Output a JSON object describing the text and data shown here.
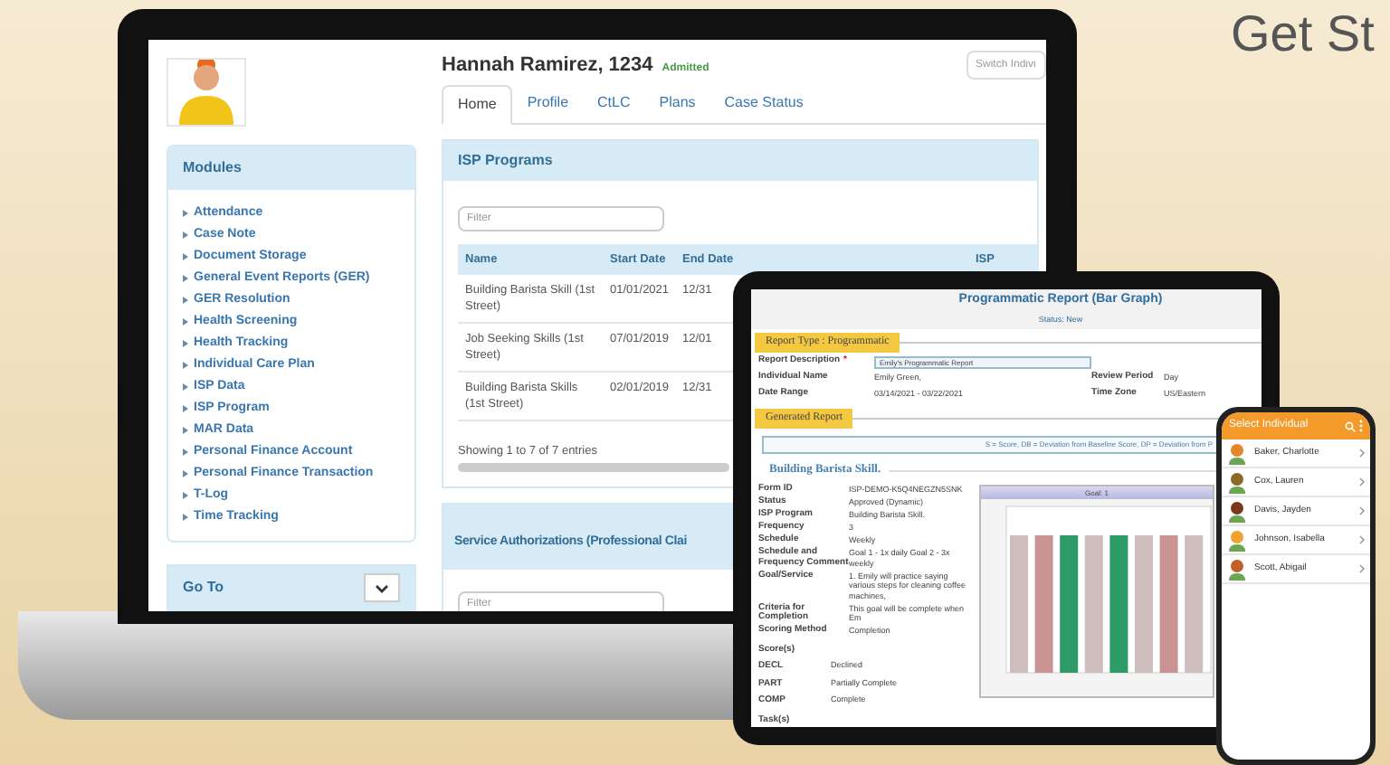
{
  "headline": "Get St",
  "laptop": {
    "header": {
      "name": "Hannah Ramirez, 1234",
      "status": "Admitted",
      "switch_placeholder": "Switch Indivi"
    },
    "tabs": [
      {
        "label": "Home",
        "selected": true
      },
      {
        "label": "Profile",
        "selected": false
      },
      {
        "label": "CtLC",
        "selected": false
      },
      {
        "label": "Plans",
        "selected": false
      },
      {
        "label": "Case Status",
        "selected": false
      }
    ],
    "modules": {
      "title": "Modules",
      "items": [
        "Attendance",
        "Case Note",
        "Document Storage",
        "General Event Reports (GER)",
        "GER Resolution",
        "Health Screening",
        "Health Tracking",
        "Individual Care Plan",
        "ISP Data",
        "ISP Program",
        "MAR Data",
        "Personal Finance Account",
        "Personal Finance Transaction",
        "T-Log",
        "Time Tracking"
      ]
    },
    "go_to": {
      "title": "Go To"
    },
    "isp_programs": {
      "title": "ISP Programs",
      "filter_placeholder": "Filter",
      "columns": [
        "Name",
        "Start Date",
        "End Date",
        "ISP"
      ],
      "rows": [
        [
          "Building Barista Skill (1st Street)",
          "01/01/2021",
          "12/31"
        ],
        [
          "Job Seeking Skills (1st Street)",
          "07/01/2019",
          "12/01"
        ],
        [
          "Building Barista Skills (1st Street)",
          "02/01/2019",
          "12/31"
        ]
      ],
      "footer": "Showing 1 to 7 of 7 entries"
    },
    "service_authorizations": {
      "title": "Service Authorizations (Professional Clai",
      "filter_placeholder": "Filter"
    }
  },
  "tablet": {
    "title": "Programmatic Report (Bar Graph)",
    "status": "Status: New",
    "report_type": "Report Type :  Programmatic",
    "report_fields": [
      {
        "label": "Report Description",
        "required_mark": "*",
        "value": "Emily's Programmatic Report",
        "kind": "input"
      },
      {
        "label": "Individual Name",
        "value": "Emily  Green,",
        "kind": "text",
        "label_2": "Review Period",
        "value_2": "Day"
      },
      {
        "label": "Date Range",
        "value": "03/14/2021 - 03/22/2021",
        "kind": "text",
        "label_2": "Time Zone",
        "value_2": "US/Eastern"
      }
    ],
    "generated": "Generated Report",
    "legend": "S = Score,  DB = Deviation from Baseline Score,  DP = Deviation from P",
    "program": "Building Barista Skill.",
    "details": [
      [
        "Form ID",
        "ISP-DEMO-K5Q4NEGZN5SNK"
      ],
      [
        "Status",
        "Approved (Dynamic)"
      ],
      [
        "ISP Program",
        "Building Barista Skill."
      ],
      [
        "Frequency",
        "3"
      ],
      [
        "Schedule",
        "Weekly"
      ],
      [
        "Schedule and Frequency Comment",
        "Goal 1 - 1x daily Goal 2 - 3x weekly"
      ],
      [
        "Goal/Service",
        "1. Emily will practice saying various steps for cleaning coffee machines,"
      ],
      [
        "Criteria for Completion",
        "This goal will be complete when Em"
      ],
      [
        "Scoring Method",
        "Completion"
      ]
    ],
    "scores_title": "Score(s)",
    "scores": [
      [
        "DECL",
        "Declined"
      ],
      [
        "PART",
        "Partially Complete"
      ],
      [
        "COMP",
        "Complete"
      ]
    ],
    "tasks_title": "Task(s)",
    "chart_title": "Goal: 1"
  },
  "phone": {
    "title": "Select Individual",
    "people": [
      "Baker, Charlotte",
      "Cox, Lauren",
      "Davis, Jayden",
      "Johnson, Isabella",
      "Scott, Abigail"
    ]
  }
}
